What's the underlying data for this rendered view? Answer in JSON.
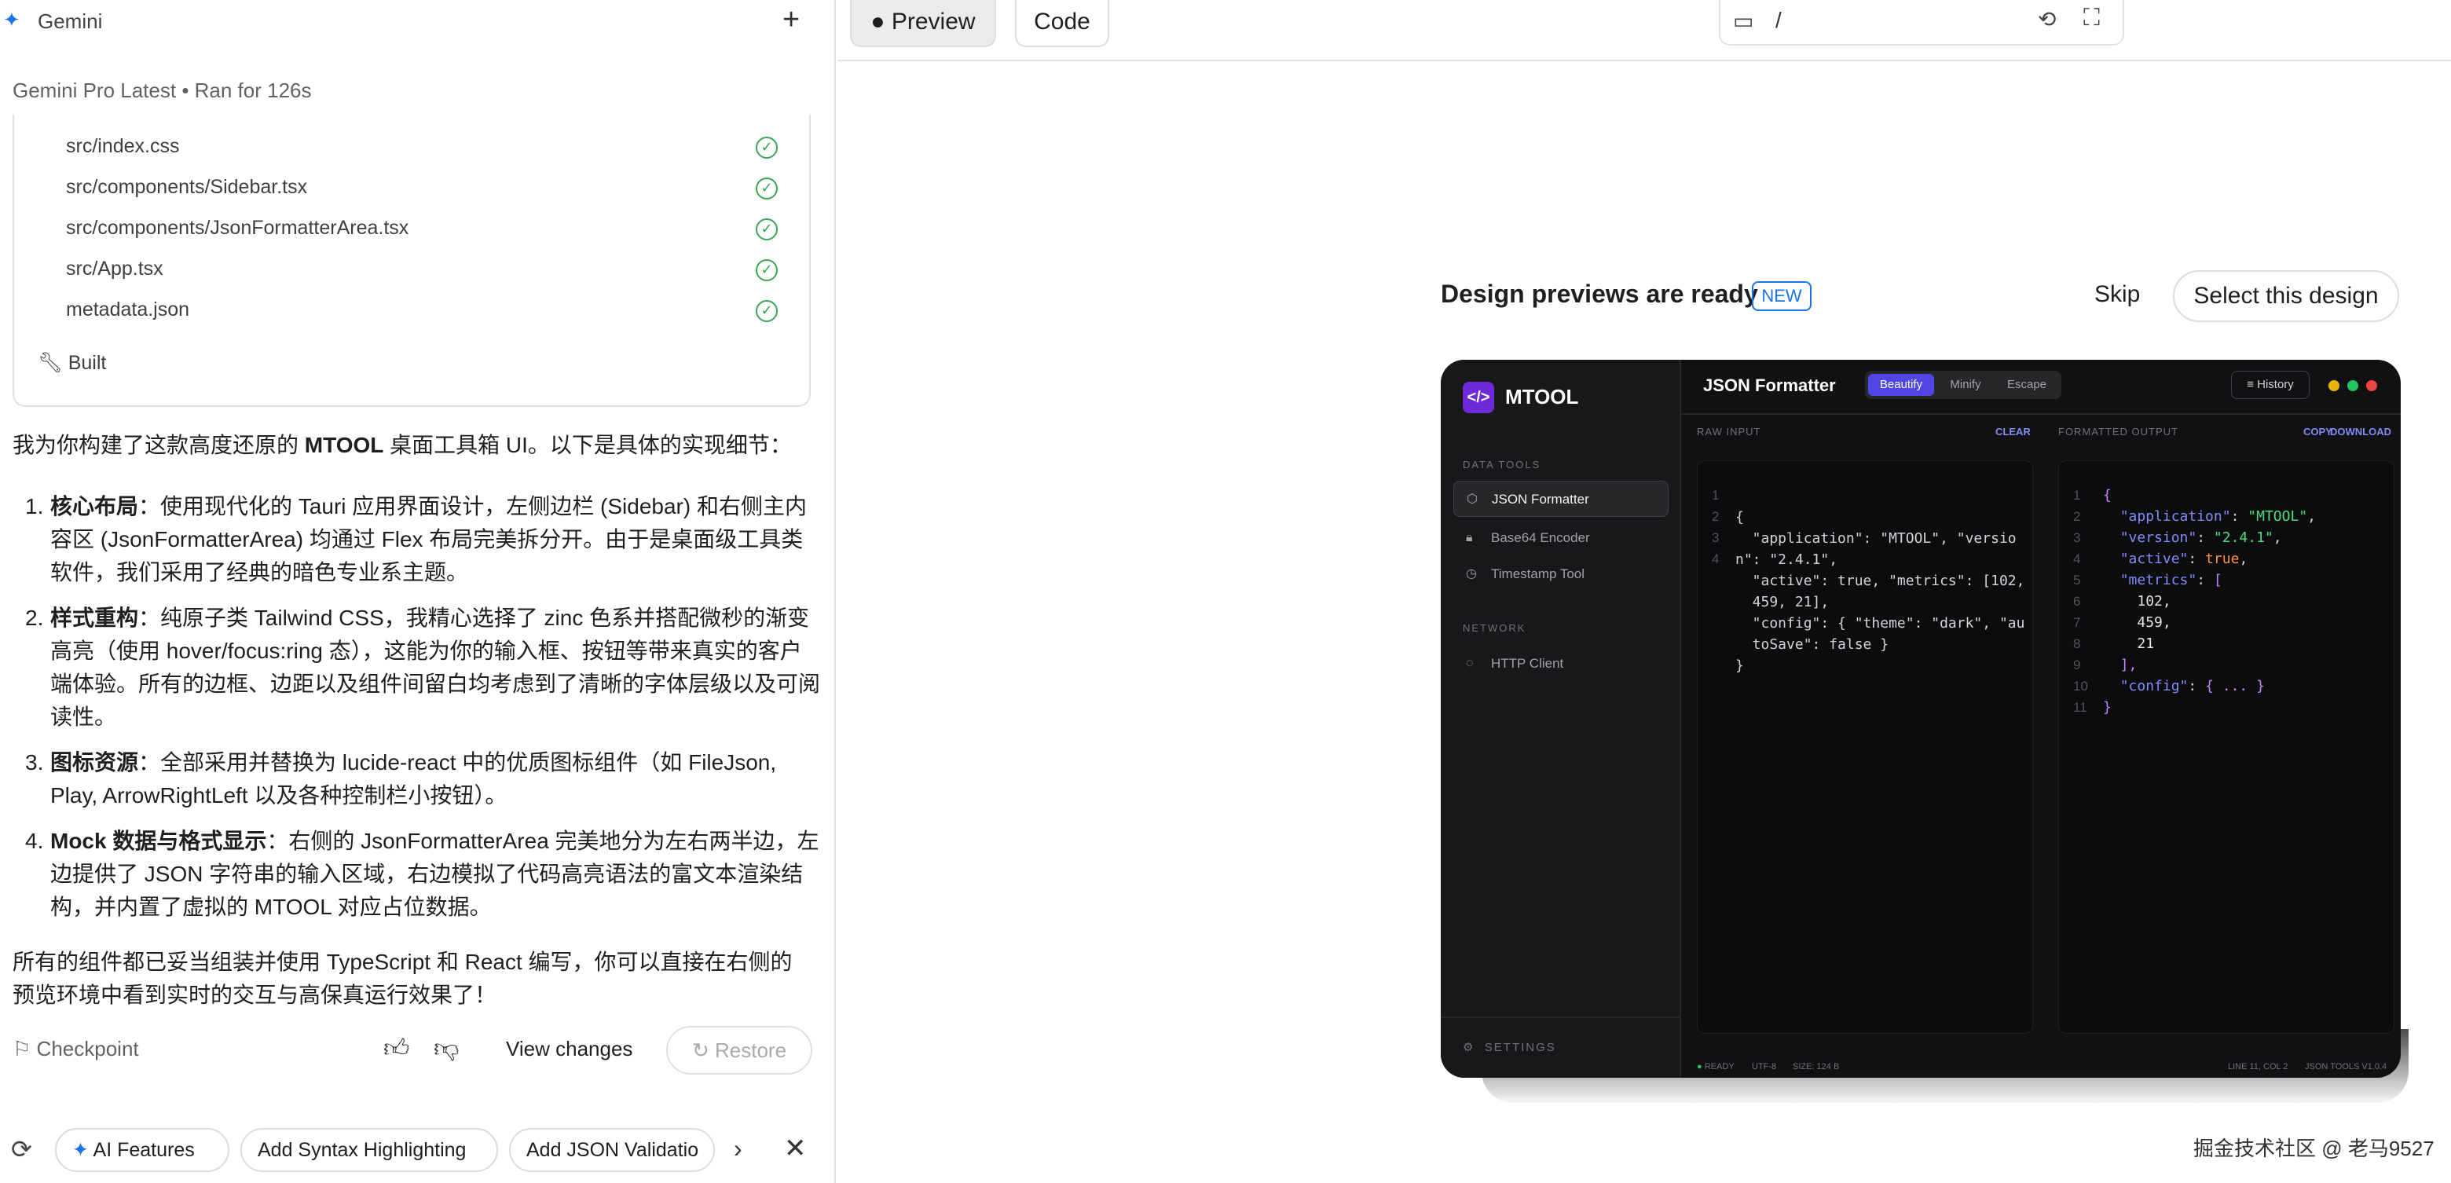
{
  "left": {
    "title": "Gemini",
    "model_info": "Gemini Pro Latest  •  Ran for 126s",
    "files": [
      "src/index.css",
      "src/components/Sidebar.tsx",
      "src/components/JsonFormatterArea.tsx",
      "src/App.tsx",
      "metadata.json"
    ],
    "built_label": "Built",
    "intro_pre": "我为你构建了这款高度还原的 ",
    "intro_bold": "MTOOL",
    "intro_post": " 桌面工具箱 UI。以下是具体的实现细节：",
    "items": [
      {
        "num": "1.",
        "title": "核心布局",
        "body": "：使用现代化的 Tauri 应用界面设计，左侧边栏 (Sidebar) 和右侧主内容区 (JsonFormatterArea) 均通过 Flex 布局完美拆分开。由于是桌面级工具类软件，我们采用了经典的暗色专业系主题。"
      },
      {
        "num": "2.",
        "title": "样式重构",
        "body": "：纯原子类 Tailwind CSS，我精心选择了 zinc 色系并搭配微秒的渐变高亮（使用 hover/focus:ring 态），这能为你的输入框、按钮等带来真实的客户端体验。所有的边框、边距以及组件间留白均考虑到了清晰的字体层级以及可阅读性。"
      },
      {
        "num": "3.",
        "title": "图标资源",
        "body": "：全部采用并替换为 lucide-react 中的优质图标组件（如 FileJson, Play, ArrowRightLeft 以及各种控制栏小按钮）。"
      },
      {
        "num": "4.",
        "title": "Mock 数据与格式显示",
        "body": "：右侧的 JsonFormatterArea 完美地分为左右两半边，左边提供了 JSON 字符串的输入区域，右边模拟了代码高亮语法的富文本渲染结构，并内置了虚拟的 MTOOL 对应占位数据。"
      }
    ],
    "outro": "所有的组件都已妥当组装并使用 TypeScript 和 React 编写，你可以直接在右侧的预览环境中看到实时的交互与高保真运行效果了！",
    "checkpoint": "Checkpoint",
    "view_changes": "View changes",
    "restore": "Restore",
    "chips": [
      "AI Features",
      "Add Syntax Highlighting",
      "Add JSON Validatio"
    ]
  },
  "right": {
    "tabs": {
      "preview": "Preview",
      "code": "Code"
    },
    "url": "/",
    "banner_title": "Design previews are ready",
    "new_badge": "NEW",
    "skip": "Skip",
    "select": "Select this design",
    "watermark": "掘金技术社区 @ 老马9527"
  },
  "mock": {
    "brand": "MTOOL",
    "section_data": "DATA TOOLS",
    "nav": [
      "JSON Formatter",
      "Base64 Encoder",
      "Timestamp Tool"
    ],
    "section_net": "NETWORK",
    "nav_net": "HTTP Client",
    "settings": "SETTINGS",
    "title": "JSON Formatter",
    "segments": [
      "Beautify",
      "Minify",
      "Escape"
    ],
    "history": "History",
    "raw_label": "RAW INPUT",
    "clear": "CLEAR",
    "out_label": "FORMATTED OUTPUT",
    "copy": "COPY",
    "download": "DOWNLOAD",
    "status": [
      "READY",
      "UTF-8",
      "SIZE: 124 B"
    ],
    "status_right": [
      "LINE 11, COL 2",
      "JSON TOOLS V1.0.4"
    ],
    "dot_colors": [
      "#eab308",
      "#22c55e",
      "#ef4444"
    ]
  }
}
